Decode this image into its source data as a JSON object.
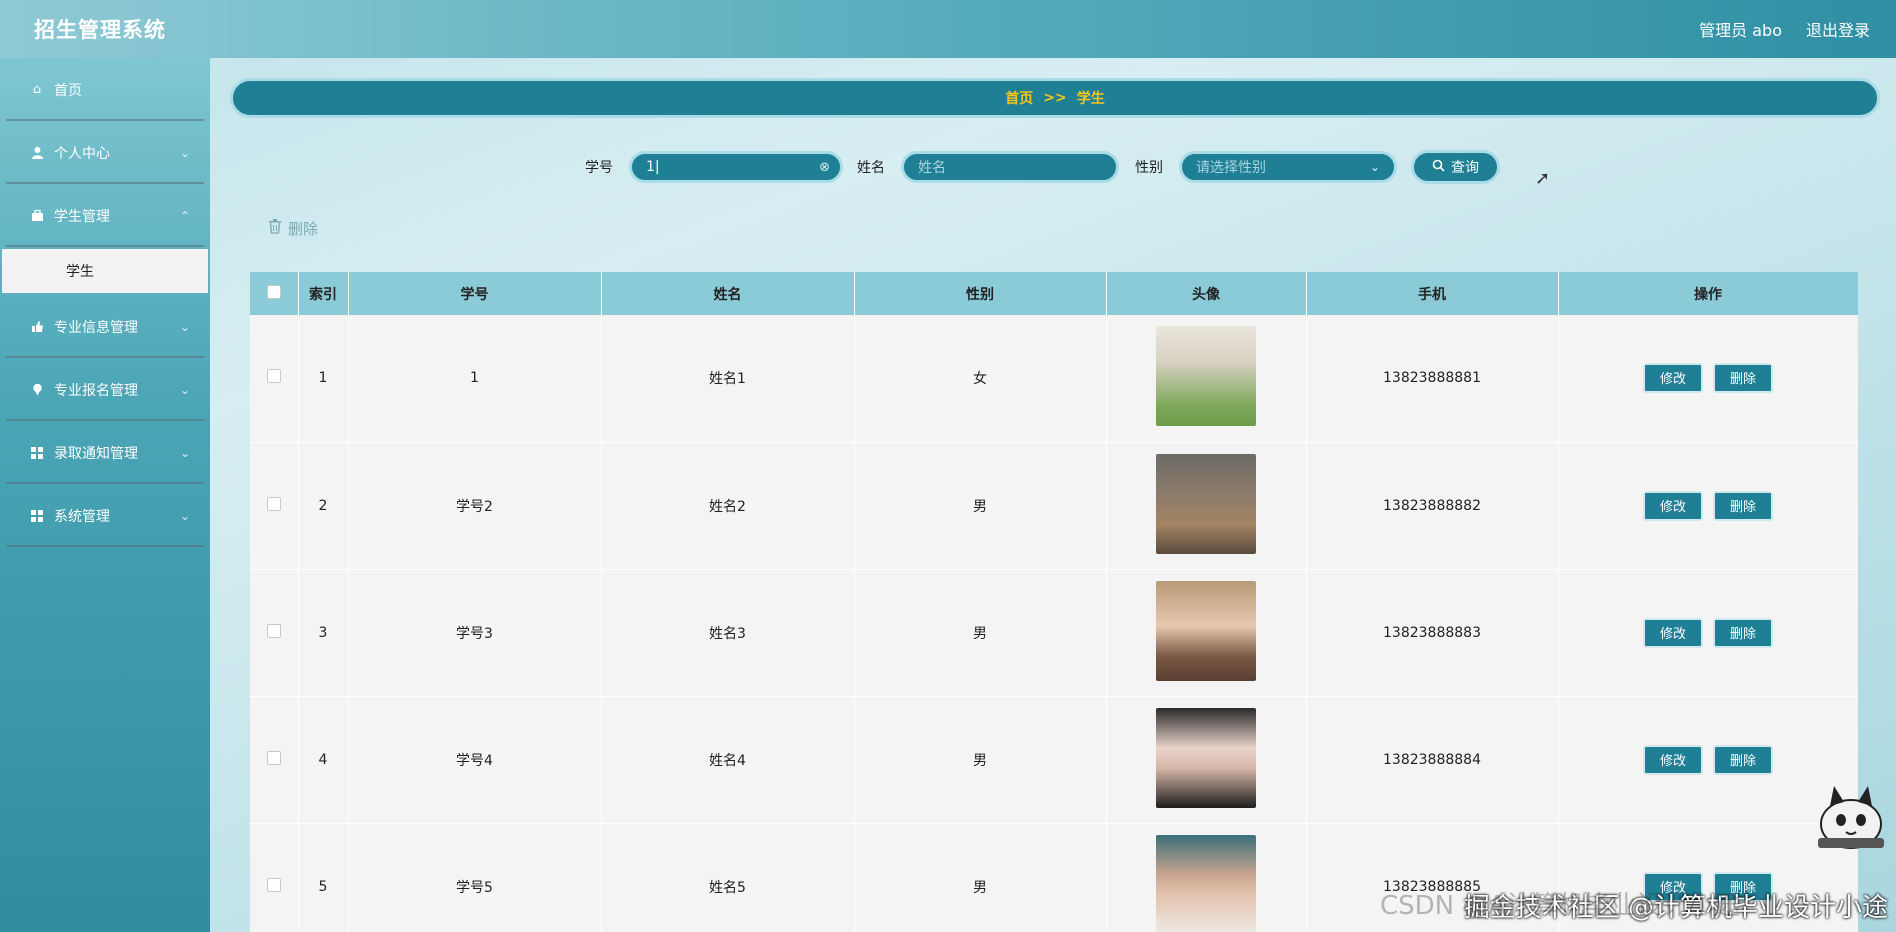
{
  "header": {
    "app_title": "招生管理系统",
    "user_label": "管理员 abo",
    "logout_label": "退出登录"
  },
  "sidebar": {
    "items": [
      {
        "label": "首页",
        "icon": "home-icon",
        "has_arrow": false
      },
      {
        "label": "个人中心",
        "icon": "user-icon",
        "has_arrow": true
      },
      {
        "label": "学生管理",
        "icon": "briefcase-icon",
        "has_arrow": true
      },
      {
        "label": "专业信息管理",
        "icon": "thumb-icon",
        "has_arrow": true
      },
      {
        "label": "专业报名管理",
        "icon": "pin-icon",
        "has_arrow": true
      },
      {
        "label": "录取通知管理",
        "icon": "grid-icon",
        "has_arrow": true
      },
      {
        "label": "系统管理",
        "icon": "grid-icon",
        "has_arrow": true
      }
    ],
    "active_sub_item": "学生"
  },
  "breadcrumb": {
    "home": "首页",
    "separator": ">>",
    "current": "学生"
  },
  "search": {
    "student_no_label": "学号",
    "student_no_value": "1",
    "name_label": "姓名",
    "name_placeholder": "姓名",
    "gender_label": "性别",
    "gender_placeholder": "请选择性别",
    "search_button": "查询"
  },
  "toolbar": {
    "delete_label": "删除"
  },
  "table": {
    "columns": [
      "索引",
      "学号",
      "姓名",
      "性别",
      "头像",
      "手机",
      "操作"
    ],
    "edit_label": "修改",
    "delete_label": "删除",
    "rows": [
      {
        "index": "1",
        "student_no": "1",
        "name": "姓名1",
        "gender": "女",
        "phone": "13823888881"
      },
      {
        "index": "2",
        "student_no": "学号2",
        "name": "姓名2",
        "gender": "男",
        "phone": "13823888882"
      },
      {
        "index": "3",
        "student_no": "学号3",
        "name": "姓名3",
        "gender": "男",
        "phone": "13823888883"
      },
      {
        "index": "4",
        "student_no": "学号4",
        "name": "姓名4",
        "gender": "男",
        "phone": "13823888884"
      },
      {
        "index": "5",
        "student_no": "学号5",
        "name": "姓名5",
        "gender": "男",
        "phone": "13823888885"
      }
    ]
  },
  "watermark": {
    "back": "CSDN @A计算机毕业设计小途",
    "front": "掘金技术社区 @计算机毕业设计小途"
  }
}
